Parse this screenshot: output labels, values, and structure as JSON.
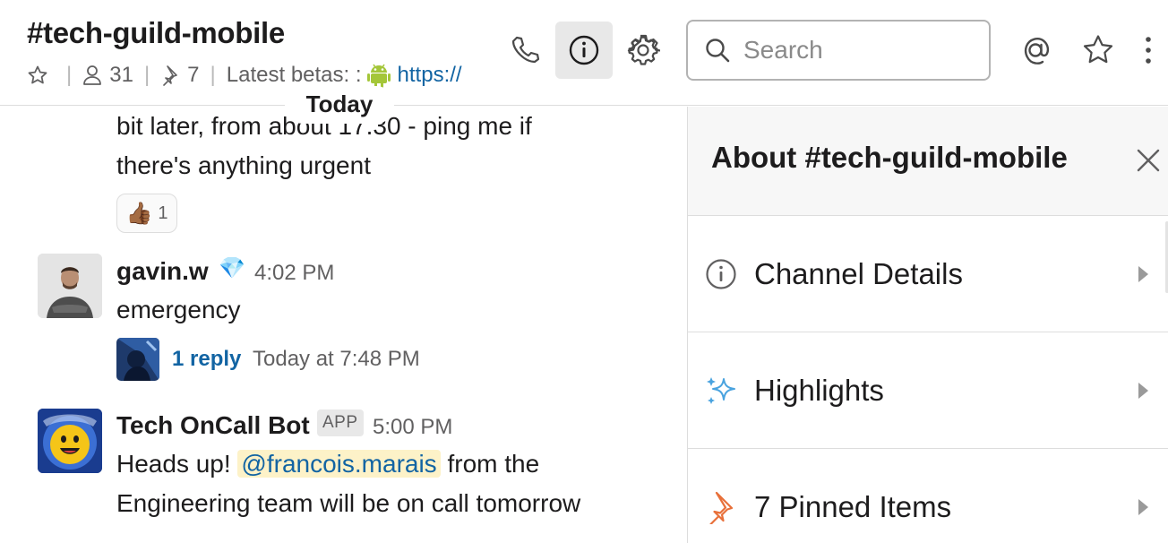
{
  "header": {
    "channel_title": "#tech-guild-mobile",
    "members_count": "31",
    "pins_count": "7",
    "topic_text": "Latest betas: :",
    "topic_link": "https://",
    "icons": [
      "phone-icon",
      "info-icon",
      "gear-icon",
      "search-icon",
      "at-icon",
      "star-icon",
      "more-icon"
    ]
  },
  "search": {
    "placeholder": "Search"
  },
  "divider": {
    "today": "Today"
  },
  "messages": [
    {
      "lines": [
        "bit later, from about 17.30 - ping me if",
        "there's anything urgent"
      ],
      "reaction": {
        "emoji": "👍🏾",
        "count": "1"
      }
    },
    {
      "author": "gavin.w",
      "badge_emoji": "💎",
      "time": "4:02 PM",
      "text": "emergency",
      "thread": {
        "reply_label": "1 reply",
        "reply_time": "Today at 7:48 PM"
      }
    },
    {
      "author": "Tech OnCall Bot",
      "app_badge": "APP",
      "time": "5:00 PM",
      "text_before": "Heads up!",
      "mention": "@francois.marais",
      "text_after": "from the",
      "line2": "Engineering team will be on call tomorrow"
    }
  ],
  "panel": {
    "title": "About #tech-guild-mobile",
    "rows": [
      {
        "label": "Channel Details",
        "icon": "info-icon"
      },
      {
        "label": "Highlights",
        "icon": "sparkles-icon"
      },
      {
        "label": "7 Pinned Items",
        "icon": "pin-icon"
      }
    ]
  },
  "colors": {
    "link": "#1264a3",
    "mention_bg": "#fdf2c8",
    "android_green": "#a4c639",
    "pin_orange": "#e8703a",
    "sparkle_blue": "#4aa3df"
  }
}
